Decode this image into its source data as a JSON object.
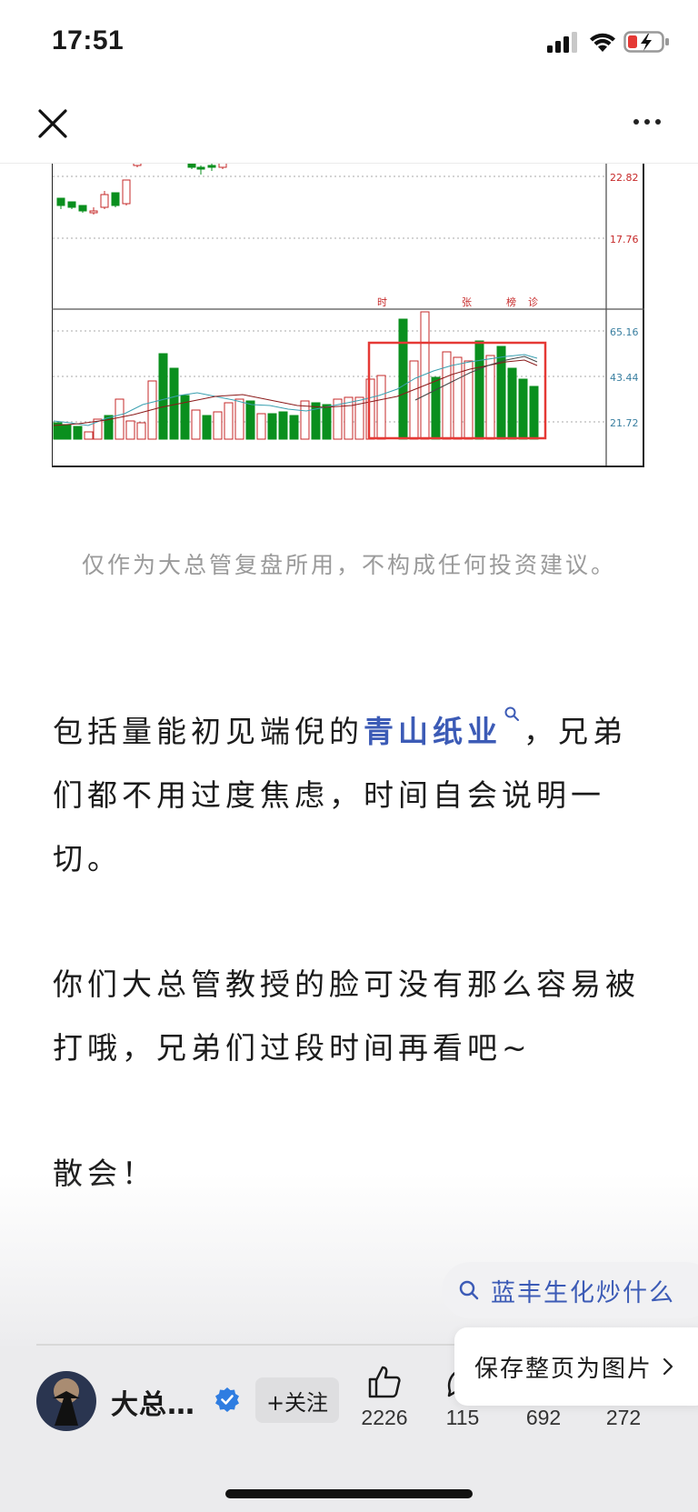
{
  "status_bar": {
    "time": "17:51"
  },
  "nav": {
    "close_icon": "close-icon",
    "more_icon": "more-icon"
  },
  "chart": {
    "price_labels": [
      "22.82",
      "17.76"
    ],
    "volume_labels": [
      "65.16",
      "43.44",
      "21.72"
    ],
    "marker_labels": [
      "时",
      "张",
      "榜",
      "诊"
    ],
    "colors": {
      "up": "#c62828",
      "down": "#0a8f1e",
      "highlight": "#e53935",
      "axis_label": "#c62828",
      "volume_label": "#3a7fa0"
    }
  },
  "caption": "仅作为大总管复盘所用，不构成任何投资建议。",
  "paragraphs": {
    "p1_before": "包括量能初见端倪的",
    "p1_link": "青山纸业",
    "p1_after": "，兄弟们都不用过度焦虑，时间自会说明一切。",
    "p2": "你们大总管教授的脸可没有那么容易被打哦，兄弟们过段时间再看吧~",
    "p3": "散会！"
  },
  "search_suggestion": "蓝丰生化炒什么",
  "save_popup": "保存整页为图片",
  "bottom_bar": {
    "author": "大总…",
    "follow": "+关注",
    "likes": "2226",
    "comments": "115",
    "stars": "692",
    "shares": "272"
  }
}
